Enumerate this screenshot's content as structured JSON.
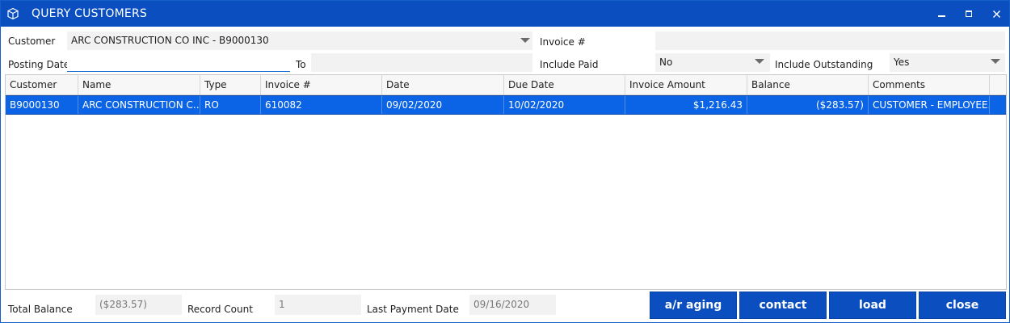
{
  "window": {
    "title": "QUERY CUSTOMERS",
    "app_icon": "cube-icon",
    "controls": [
      "minimize-icon",
      "maximize-icon",
      "close-icon"
    ]
  },
  "filters": {
    "customer_label": "Customer",
    "customer_value": "ARC CONSTRUCTION CO INC - B9000130",
    "invoice_label": "Invoice #",
    "invoice_value": "",
    "posting_date_label": "Posting Date",
    "posting_date_from": "",
    "to_label": "To",
    "posting_date_to": "",
    "include_paid_label": "Include Paid",
    "include_paid_value": "No",
    "include_outstanding_label": "Include Outstanding",
    "include_outstanding_value": "Yes"
  },
  "grid": {
    "columns": [
      "Customer",
      "Name",
      "Type",
      "Invoice #",
      "Date",
      "Due Date",
      "Invoice Amount",
      "Balance",
      "Comments"
    ],
    "rows": [
      {
        "customer": "B9000130",
        "name": "ARC CONSTRUCTION C...",
        "type": "RO",
        "invoice": "610082",
        "date": "09/02/2020",
        "due_date": "10/02/2020",
        "invoice_amount": "$1,216.43",
        "balance": "($283.57)",
        "comments": "CUSTOMER - EMPLOYEE..."
      }
    ]
  },
  "footer": {
    "total_balance_label": "Total Balance",
    "total_balance_value": "($283.57)",
    "record_count_label": "Record Count",
    "record_count_value": "1",
    "last_payment_label": "Last Payment Date",
    "last_payment_value": "09/16/2020"
  },
  "buttons": {
    "ar_aging": "a/r aging",
    "contact": "contact",
    "load": "load",
    "close": "close"
  },
  "colors": {
    "titlebar": "#0a4ec0",
    "selected_row": "#0b63e5",
    "button": "#0a4ec0"
  }
}
